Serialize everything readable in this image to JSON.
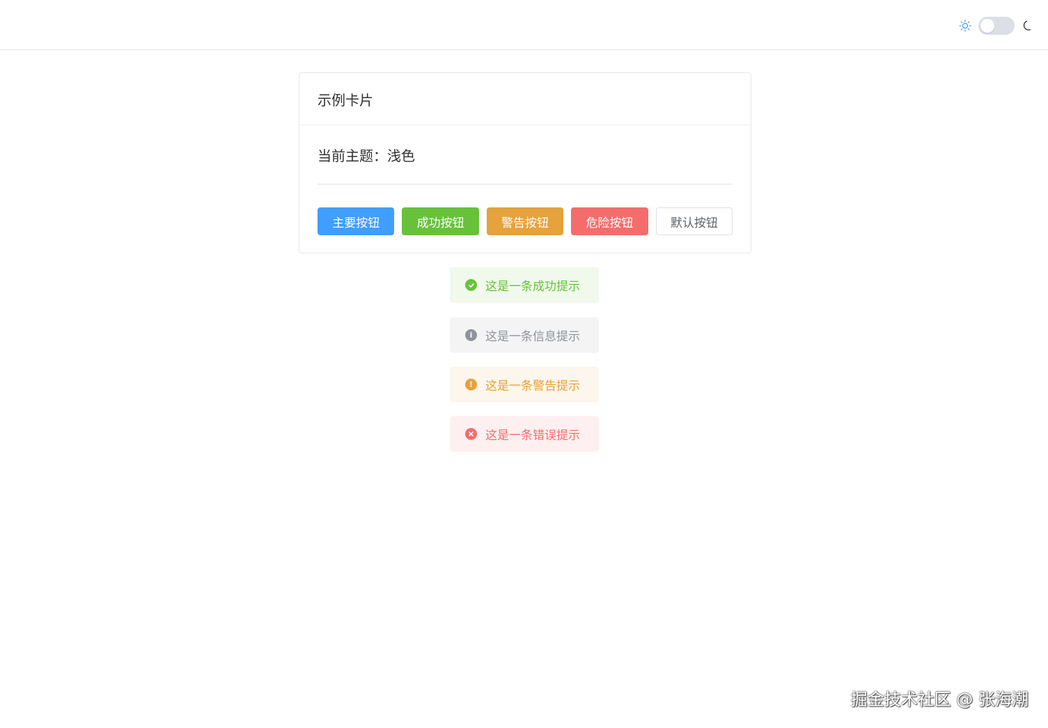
{
  "header": {
    "theme_toggle": {
      "left_icon": "sun-icon",
      "right_icon": "moon-icon",
      "is_dark": false
    }
  },
  "card": {
    "title": "示例卡片",
    "theme_text": "当前主题：浅色",
    "buttons": [
      {
        "label": "主要按钮",
        "type": "primary",
        "color": "#409eff"
      },
      {
        "label": "成功按钮",
        "type": "success",
        "color": "#67c23a"
      },
      {
        "label": "警告按钮",
        "type": "warning",
        "color": "#e6a23c"
      },
      {
        "label": "危险按钮",
        "type": "danger",
        "color": "#f56c6c"
      },
      {
        "label": "默认按钮",
        "type": "default",
        "color": "#ffffff"
      }
    ]
  },
  "alerts": [
    {
      "text": "这是一条成功提示",
      "type": "success",
      "icon": "check-circle-icon"
    },
    {
      "text": "这是一条信息提示",
      "type": "info",
      "icon": "info-circle-icon"
    },
    {
      "text": "这是一条警告提示",
      "type": "warning",
      "icon": "warning-circle-icon"
    },
    {
      "text": "这是一条错误提示",
      "type": "error",
      "icon": "close-circle-icon"
    }
  ],
  "watermark": "掘金技术社区 @ 张海潮"
}
